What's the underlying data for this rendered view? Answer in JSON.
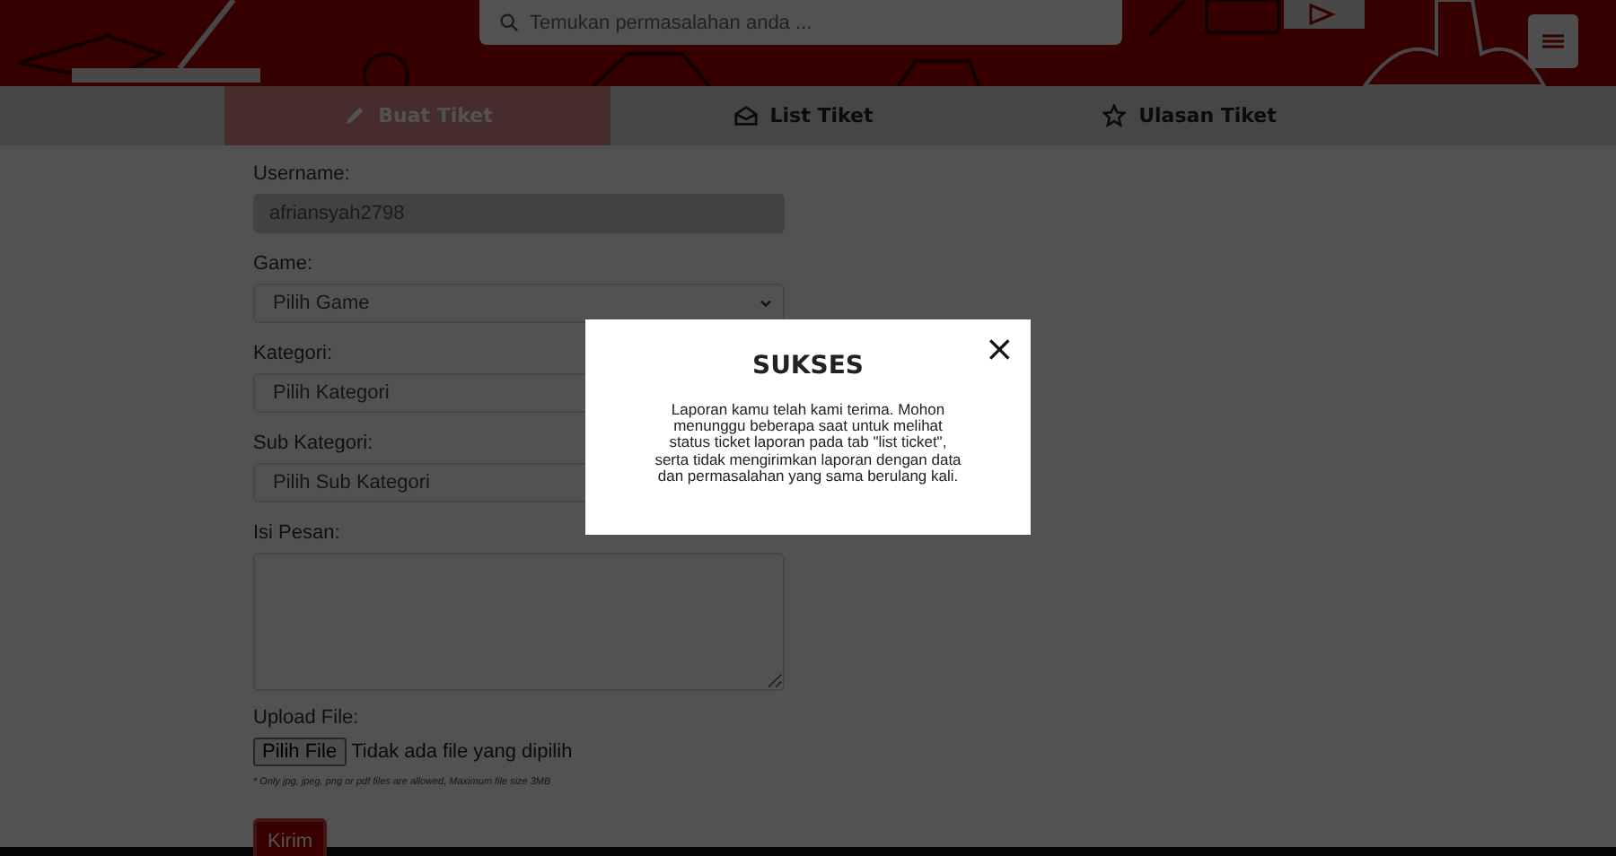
{
  "search": {
    "placeholder": "Temukan permasalahan anda ..."
  },
  "tabs": [
    {
      "label": "Buat Tiket",
      "selected": true
    },
    {
      "label": "List Tiket",
      "selected": false
    },
    {
      "label": "Ulasan Tiket",
      "selected": false
    }
  ],
  "form": {
    "fields": [
      {
        "kind": "text",
        "label": "Username:",
        "value": "afriansyah2798",
        "disabled": true
      },
      {
        "kind": "select",
        "label": "Game:",
        "value": "Pilih Game"
      },
      {
        "kind": "select",
        "label": "Kategori:",
        "value": "Pilih Kategori"
      },
      {
        "kind": "select",
        "label": "Sub Kategori:",
        "value": "Pilih Sub Kategori"
      },
      {
        "kind": "textarea",
        "label": "Isi Pesan:"
      }
    ],
    "upload": {
      "label": "Upload File:",
      "button": "Pilih File",
      "status": "Tidak ada file yang dipilih",
      "note": "* Only jpg, jpeg, png or pdf files are allowed, Maximum file size 3MB"
    },
    "submit": "Kirim"
  },
  "modal": {
    "title": "SUKSES",
    "message": "Laporan kamu telah kami terima. Mohon menunggu beberapa saat untuk melihat status ticket laporan pada tab \"list ticket\", serta tidak mengirimkan laporan dengan data dan permasalahan yang sama berulang kali.",
    "close": "×"
  }
}
